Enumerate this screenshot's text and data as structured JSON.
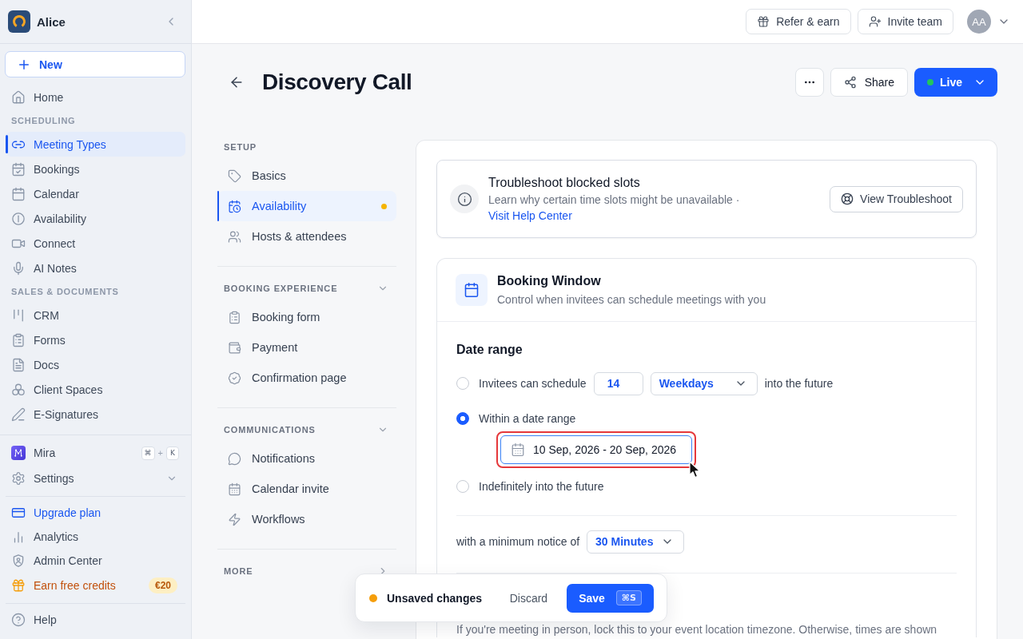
{
  "sidebar": {
    "workspace": "Alice",
    "new_button": "New",
    "sections": [
      {
        "items": [
          {
            "label": "Home",
            "selected": false
          }
        ]
      },
      {
        "heading": "SCHEDULING",
        "items": [
          {
            "label": "Meeting Types",
            "selected": true
          },
          {
            "label": "Bookings",
            "selected": false
          },
          {
            "label": "Calendar",
            "selected": false
          },
          {
            "label": "Availability",
            "selected": false
          },
          {
            "label": "Connect",
            "selected": false
          },
          {
            "label": "AI Notes",
            "selected": false
          }
        ]
      },
      {
        "heading": "SALES & DOCUMENTS",
        "items": [
          {
            "label": "CRM",
            "selected": false
          },
          {
            "label": "Forms",
            "selected": false
          },
          {
            "label": "Docs",
            "selected": false
          },
          {
            "label": "Client Spaces",
            "selected": false
          },
          {
            "label": "E-Signatures",
            "selected": false
          }
        ]
      }
    ],
    "footer_groups": [
      [
        {
          "kind": "shortcut",
          "label": "Mira",
          "keys": [
            "⌘",
            "K"
          ],
          "joiner": "+"
        },
        {
          "kind": "expandable",
          "label": "Settings"
        }
      ],
      [
        {
          "kind": "accent",
          "label": "Upgrade plan"
        },
        {
          "kind": "plain",
          "label": "Analytics"
        },
        {
          "kind": "plain",
          "label": "Admin Center"
        },
        {
          "kind": "reward",
          "label": "Earn free credits",
          "badge": "€20"
        }
      ],
      [
        {
          "kind": "plain",
          "label": "Help"
        }
      ]
    ]
  },
  "top_bar": {
    "buttons": [
      "Refer & earn",
      "Invite team"
    ],
    "avatar": "AA"
  },
  "page": {
    "title": "Discovery Call",
    "share_button": "Share",
    "publish": {
      "label": "Live",
      "on": true
    }
  },
  "settings_nav": {
    "sections": [
      {
        "kind": "static",
        "heading": "SETUP",
        "items": [
          {
            "label": "Basics",
            "selected": false,
            "modified": false
          },
          {
            "label": "Availability",
            "selected": true,
            "modified": true
          },
          {
            "label": "Hosts & attendees",
            "selected": false,
            "modified": false
          }
        ]
      },
      {
        "kind": "collapsible",
        "heading": "BOOKING EXPERIENCE",
        "expanded": true,
        "items": [
          {
            "label": "Booking form",
            "selected": false,
            "modified": false
          },
          {
            "label": "Payment",
            "selected": false,
            "modified": false
          },
          {
            "label": "Confirmation page",
            "selected": false,
            "modified": false
          }
        ]
      },
      {
        "kind": "collapsible",
        "heading": "COMMUNICATIONS",
        "expanded": true,
        "items": [
          {
            "label": "Notifications",
            "selected": false,
            "modified": false
          },
          {
            "label": "Calendar invite",
            "selected": false,
            "modified": false
          },
          {
            "label": "Workflows",
            "selected": false,
            "modified": false
          }
        ]
      },
      {
        "kind": "collapsible",
        "heading": "MORE",
        "expanded": false
      }
    ]
  },
  "troubleshoot": {
    "title": "Troubleshoot blocked slots",
    "text": "Learn why certain time slots might be unavailable ·",
    "link": "Visit Help Center",
    "button": "View Troubleshoot"
  },
  "booking_window": {
    "title": "Booking Window",
    "subtitle": "Control when invitees can schedule meetings with you",
    "date_range": {
      "heading": "Date range",
      "options": [
        {
          "kind": "rolling",
          "selected": false,
          "before": "Invitees can schedule",
          "amount": "14",
          "unit": "Weekdays",
          "after": "into the future"
        },
        {
          "kind": "range",
          "selected": true,
          "label": "Within a date range",
          "value": "10 Sep, 2026 - 20 Sep, 2026",
          "highlighted": true
        },
        {
          "kind": "plain",
          "selected": false,
          "label": "Indefinitely into the future"
        }
      ]
    },
    "minimum_notice": {
      "label": "with a minimum notice of",
      "value": "30 Minutes"
    },
    "timezone_note": "If you're meeting in person, lock this to your event location timezone. Otherwise, times are shown"
  },
  "unsaved_bar": {
    "message": "Unsaved changes",
    "discard": "Discard",
    "save": "Save",
    "shortcut": "⌘S"
  }
}
